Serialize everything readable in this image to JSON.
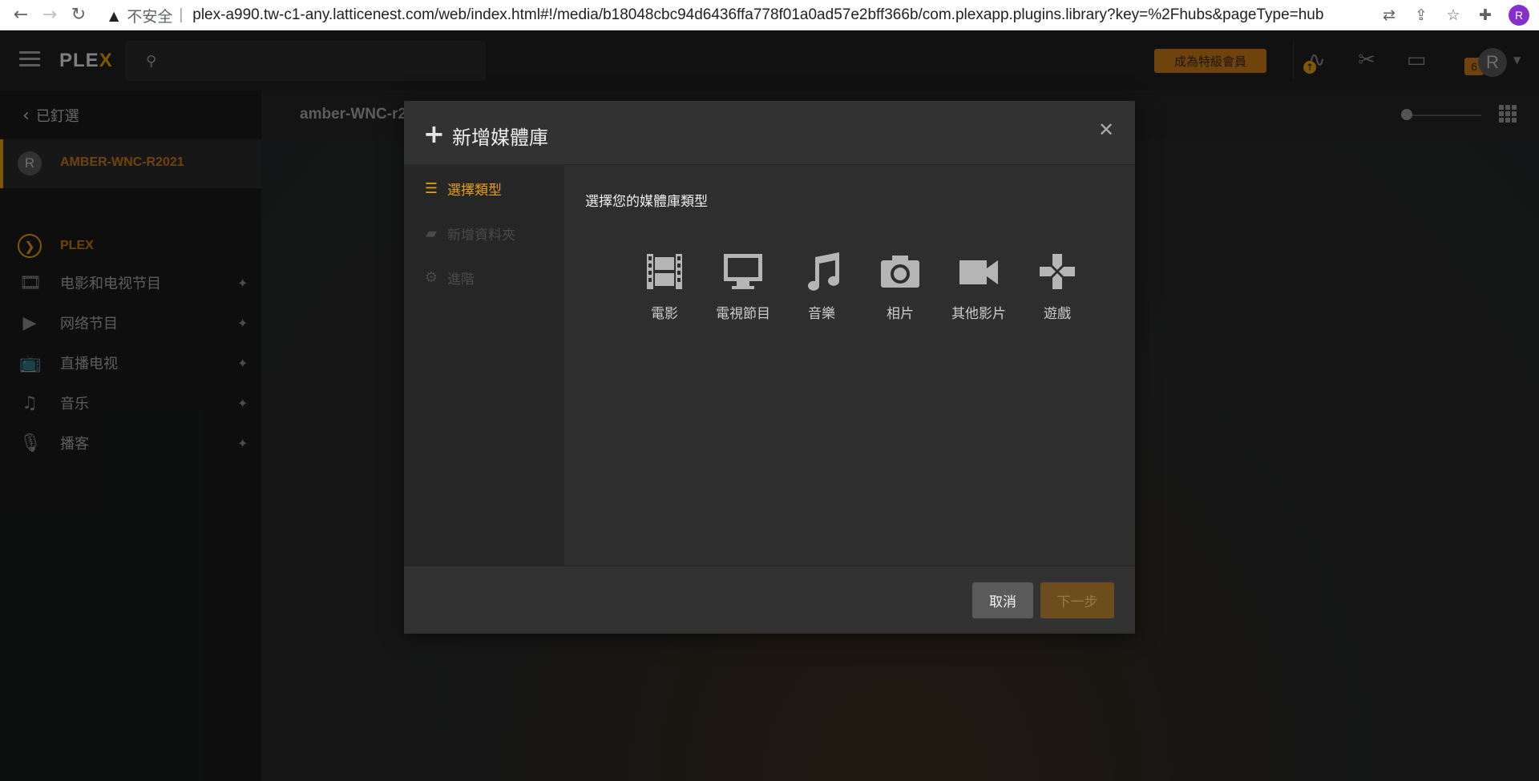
{
  "browser": {
    "insecure_label": "不安全",
    "separator": "|",
    "url": "plex-a990.tw-c1-any.latticenest.com/web/index.html#!/media/b18048cbc94d6436ffa778f01a0ad57e2bff366b/com.plexapp.plugins.library?key=%2Fhubs&pageType=hub",
    "profile_initial": "R"
  },
  "topbar": {
    "logo_main": "PLE",
    "logo_x": "X",
    "search_placeholder": "",
    "premium_label": "成為特級會員",
    "notification_count": "6",
    "user_initial": "R"
  },
  "sidebar": {
    "pinned_label": "已釘選",
    "server": {
      "initial": "R",
      "name": "AMBER-WNC-R2021"
    },
    "plex_label": "PLEX",
    "items": [
      {
        "label": "电影和电视节目",
        "icon": "film-icon"
      },
      {
        "label": "网络节目",
        "icon": "play-icon"
      },
      {
        "label": "直播电视",
        "icon": "tv-icon"
      },
      {
        "label": "音乐",
        "icon": "music-icon"
      },
      {
        "label": "播客",
        "icon": "microphone-icon"
      }
    ]
  },
  "main": {
    "title": "amber-WNC-r2"
  },
  "dialog": {
    "title": "新增媒體庫",
    "subtitle": "選擇您的媒體庫類型",
    "steps": [
      "選擇類型",
      "新增資料夾",
      "進階"
    ],
    "types": [
      {
        "label": "電影",
        "icon": "film-icon"
      },
      {
        "label": "電視節目",
        "icon": "tv-icon"
      },
      {
        "label": "音樂",
        "icon": "music-icon"
      },
      {
        "label": "相片",
        "icon": "camera-icon"
      },
      {
        "label": "其他影片",
        "icon": "video-camera-icon"
      },
      {
        "label": "遊戲",
        "icon": "gamepad-icon"
      }
    ],
    "cancel_label": "取消",
    "next_label": "下一步"
  },
  "colors": {
    "accent": "#e5a00d",
    "accent_dark": "#cc7b19",
    "background": "#1f2021"
  }
}
